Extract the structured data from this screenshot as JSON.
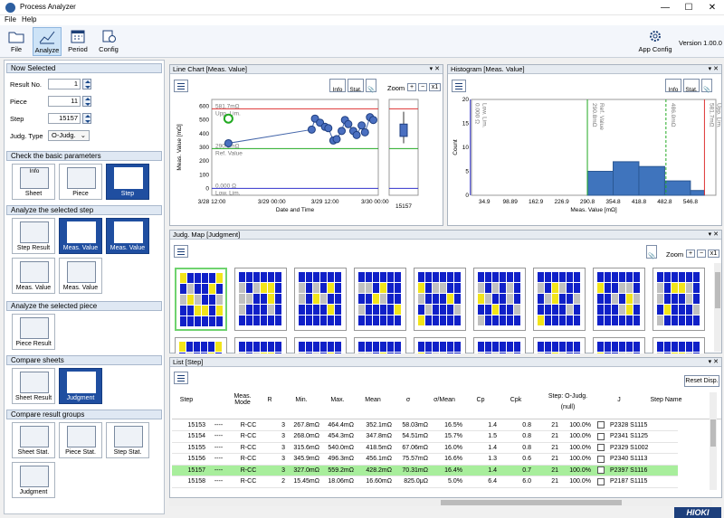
{
  "window": {
    "title": "Process Analyzer"
  },
  "menu": [
    "File",
    "Help"
  ],
  "toolbar": {
    "buttons": [
      {
        "label": "File",
        "icon": "folder-icon"
      },
      {
        "label": "Analyze",
        "icon": "analyze-chart-icon",
        "selected": true
      },
      {
        "label": "Period",
        "icon": "calendar-icon"
      },
      {
        "label": "Config",
        "icon": "config-icon"
      }
    ],
    "app_config": "App Config",
    "version": "Version 1.00.0"
  },
  "now_selected": {
    "header": "Now Selected",
    "result_no_label": "Result No.",
    "result_no": "1",
    "piece_label": "Piece",
    "piece": "11",
    "step_label": "Step",
    "step": "15157",
    "judg_type_label": "Judg. Type",
    "judg_type": "O-Judg."
  },
  "sections": {
    "basic": {
      "header": "Check the basic parameters",
      "tiles": [
        "Sheet",
        "Piece",
        "Step"
      ]
    },
    "step": {
      "header": "Analyze the selected step",
      "tiles": [
        "Step Result",
        "Meas. Value",
        "Meas. Value",
        "Meas. Value",
        "Meas. Value"
      ]
    },
    "piece": {
      "header": "Analyze the selected piece",
      "tiles": [
        "Piece Result"
      ]
    },
    "sheets": {
      "header": "Compare sheets",
      "tiles": [
        "Sheet Result",
        "Judgment"
      ]
    },
    "groups": {
      "header": "Compare result groups",
      "tiles": [
        "Sheet Stat.",
        "Piece Stat.",
        "Step Stat.",
        "Judgment"
      ]
    },
    "info_tile": "Info"
  },
  "line_chart": {
    "title": "Line Chart [Meas. Value]",
    "info": "Info",
    "stat": "Stat.",
    "zoom": "Zoom",
    "zoom_plus": "+",
    "zoom_minus": "−",
    "zoom_x1": "x1",
    "upp_value": "581.7mΩ",
    "upp_label": "Upp. Lim.",
    "ref_value": "290.8mΩ",
    "ref_label": "Ref. Value",
    "low_value": "0.000 Ω",
    "low_label": "Low. Lim.",
    "box_label": "15157"
  },
  "histogram": {
    "title": "Histogram [Meas. Value]",
    "info": "Info",
    "stat": "Stat.",
    "markers": [
      "0.000 Ω",
      "Low. Lim.",
      "290.8mΩ",
      "Ref. Value",
      "486.0mΩ",
      "581.7mΩ",
      "Upp. Lim."
    ]
  },
  "judg_map": {
    "title": "Judg. Map [Judgment]",
    "zoom": "Zoom",
    "zoom_plus": "+",
    "zoom_minus": "−",
    "zoom_x1": "x1",
    "colors": {
      "ok": "#1020c8",
      "warn": "#f2e41a",
      "empty": "#c0c0c0"
    }
  },
  "list": {
    "title": "List [Step]",
    "reset": "Reset Disp.",
    "headers": [
      "Step",
      "",
      "Meas. Mode",
      "R",
      "Min.",
      "Max.",
      "Mean",
      "σ",
      "σ/Mean",
      "Cp",
      "Cpk",
      "Step: O-Judg.",
      "J",
      "Step Name"
    ],
    "subheader": "(null)",
    "rows": [
      [
        "15153",
        "----",
        "R-CC",
        "3",
        "267.8mΩ",
        "464.4mΩ",
        "352.1mΩ",
        "58.03mΩ",
        "16.5%",
        "1.4",
        "0.8",
        "21",
        "100.0%",
        "P2328 S1115"
      ],
      [
        "15154",
        "----",
        "R-CC",
        "3",
        "268.0mΩ",
        "454.3mΩ",
        "347.8mΩ",
        "54.51mΩ",
        "15.7%",
        "1.5",
        "0.8",
        "21",
        "100.0%",
        "P2341 S1125"
      ],
      [
        "15155",
        "----",
        "R-CC",
        "3",
        "315.6mΩ",
        "540.0mΩ",
        "418.5mΩ",
        "67.06mΩ",
        "16.0%",
        "1.4",
        "0.8",
        "21",
        "100.0%",
        "P2329 S1002"
      ],
      [
        "15156",
        "----",
        "R-CC",
        "3",
        "345.9mΩ",
        "496.3mΩ",
        "456.1mΩ",
        "75.57mΩ",
        "16.6%",
        "1.3",
        "0.6",
        "21",
        "100.0%",
        "P2340 S1113"
      ],
      [
        "15157",
        "----",
        "R-CC",
        "3",
        "327.0mΩ",
        "559.2mΩ",
        "428.2mΩ",
        "70.31mΩ",
        "16.4%",
        "1.4",
        "0.7",
        "21",
        "100.0%",
        "P2397 S1116"
      ],
      [
        "15158",
        "----",
        "R-CC",
        "2",
        "15.45mΩ",
        "18.06mΩ",
        "16.60mΩ",
        "825.0μΩ",
        "5.0%",
        "6.4",
        "6.0",
        "21",
        "100.0%",
        "P2187 S1115"
      ]
    ],
    "selected_row": 4
  },
  "brand": "HIOKI",
  "chart_data": [
    {
      "type": "line",
      "title": "Line Chart [Meas. Value]",
      "xlabel": "Date and Time",
      "ylabel": "Meas. Value [mΩ]",
      "x_ticks": [
        "3/28 12:00",
        "3/29 00:00",
        "3/29 12:00",
        "3/30 00:00"
      ],
      "y_ticks": [
        0,
        100,
        200,
        300,
        400,
        500,
        600
      ],
      "ylim": [
        -50,
        650
      ],
      "series": [
        {
          "name": "Meas. Value",
          "points": [
            [
              0.1,
              330
            ],
            [
              0.6,
              430
            ],
            [
              0.62,
              510
            ],
            [
              0.65,
              480
            ],
            [
              0.68,
              450
            ],
            [
              0.7,
              440
            ],
            [
              0.73,
              350
            ],
            [
              0.75,
              360
            ],
            [
              0.78,
              420
            ],
            [
              0.8,
              500
            ],
            [
              0.82,
              470
            ],
            [
              0.85,
              420
            ],
            [
              0.87,
              390
            ],
            [
              0.9,
              460
            ],
            [
              0.92,
              410
            ],
            [
              0.95,
              520
            ],
            [
              0.97,
              500
            ]
          ]
        }
      ]
    },
    {
      "type": "bar",
      "title": "Histogram [Meas. Value]",
      "xlabel": "Meas. Value [mΩ]",
      "ylabel": "Count",
      "x_ticks": [
        "34.9",
        "98.89",
        "162.9",
        "226.9",
        "290.8",
        "354.8",
        "418.8",
        "482.8",
        "546.8"
      ],
      "y_ticks": [
        0,
        5,
        10,
        15,
        20
      ],
      "bins": [
        290.8,
        354.8,
        418.8,
        482.8,
        546.8,
        581.7
      ],
      "values": [
        5,
        7,
        6,
        3,
        1
      ]
    }
  ]
}
